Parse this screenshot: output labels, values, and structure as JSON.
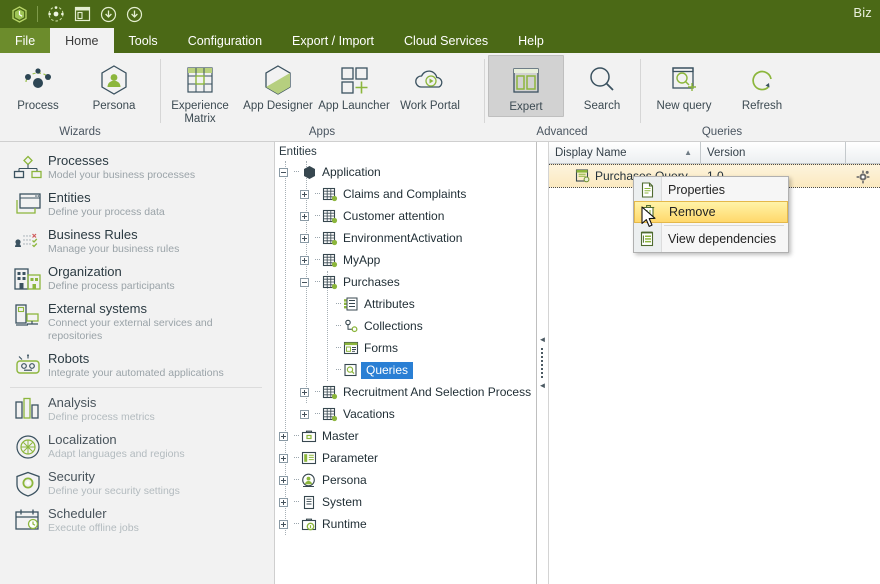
{
  "titlebar": {
    "app_title": "Biz",
    "icons": [
      "app-logo-icon",
      "process-nav-icon",
      "window-layout-icon",
      "download-icon",
      "download-alt-icon"
    ]
  },
  "menubar": {
    "items": [
      {
        "label": "File",
        "state": "file"
      },
      {
        "label": "Home",
        "state": "active"
      },
      {
        "label": "Tools",
        "state": "normal"
      },
      {
        "label": "Configuration",
        "state": "normal"
      },
      {
        "label": "Export / Import",
        "state": "normal"
      },
      {
        "label": "Cloud Services",
        "state": "normal"
      },
      {
        "label": "Help",
        "state": "normal"
      }
    ]
  },
  "ribbon": {
    "groups": [
      {
        "label": "Wizards",
        "buttons": [
          {
            "label": "Process",
            "icon": "process-network-icon",
            "selected": false
          },
          {
            "label": "Persona",
            "icon": "persona-hexagon-icon",
            "selected": false
          }
        ]
      },
      {
        "label": "Apps",
        "buttons": [
          {
            "label": "Experience Matrix",
            "icon": "matrix-grid-icon",
            "selected": false
          },
          {
            "label": "App Designer",
            "icon": "hexagon-designer-icon",
            "selected": false
          },
          {
            "label": "App Launcher",
            "icon": "squares-plus-icon",
            "selected": false
          },
          {
            "label": "Work Portal",
            "icon": "cloud-play-icon",
            "selected": false
          }
        ]
      },
      {
        "label": "Advanced",
        "buttons": [
          {
            "label": "Expert",
            "icon": "panels-expert-icon",
            "selected": true
          },
          {
            "label": "Search",
            "icon": "search-icon",
            "selected": false
          }
        ]
      },
      {
        "label": "Queries",
        "buttons": [
          {
            "label": "New query",
            "icon": "new-query-icon",
            "selected": false
          },
          {
            "label": "Refresh",
            "icon": "refresh-icon",
            "selected": false
          }
        ]
      }
    ]
  },
  "sidebar": {
    "items": [
      {
        "title": "Processes",
        "subtitle": "Model your business processes",
        "icon": "process-tree-icon",
        "dim": false
      },
      {
        "title": "Entities",
        "subtitle": "Define your process data",
        "icon": "entities-window-icon",
        "dim": false
      },
      {
        "title": "Business  Rules",
        "subtitle": "Manage your business rules",
        "icon": "business-rules-icon",
        "dim": false
      },
      {
        "title": "Organization",
        "subtitle": "Define process participants",
        "icon": "organization-building-icon",
        "dim": false
      },
      {
        "title": "External systems",
        "subtitle": "Connect your external services and repositories",
        "icon": "external-systems-icon",
        "dim": false
      },
      {
        "title": "Robots",
        "subtitle": "Integrate your automated applications",
        "icon": "robot-icon",
        "dim": false
      },
      {
        "title": "Analysis",
        "subtitle": "Define  process  metrics",
        "icon": "analysis-bars-icon",
        "dim": true
      },
      {
        "title": "Localization",
        "subtitle": "Adapt  languages  and regions",
        "icon": "globe-icon",
        "dim": true
      },
      {
        "title": "Security",
        "subtitle": "Define  your  security  settings",
        "icon": "shield-gear-icon",
        "dim": true
      },
      {
        "title": "Scheduler",
        "subtitle": "Execute offline  jobs",
        "icon": "calendar-clock-icon",
        "dim": true
      }
    ],
    "divider_after_index": 5
  },
  "tree": {
    "header": "Entities",
    "nodes": [
      {
        "label": "Application",
        "depth": 0,
        "expander": "minus",
        "icon": "application-hex-icon",
        "selected": false
      },
      {
        "label": "Claims and Complaints",
        "depth": 1,
        "expander": "plus",
        "icon": "entity-table-icon",
        "selected": false
      },
      {
        "label": "Customer attention",
        "depth": 1,
        "expander": "plus",
        "icon": "entity-table-icon",
        "selected": false
      },
      {
        "label": "EnvironmentActivation",
        "depth": 1,
        "expander": "plus",
        "icon": "entity-table-icon",
        "selected": false
      },
      {
        "label": "MyApp",
        "depth": 1,
        "expander": "plus",
        "icon": "entity-table-icon",
        "selected": false
      },
      {
        "label": "Purchases",
        "depth": 1,
        "expander": "minus",
        "icon": "entity-table-icon",
        "selected": false
      },
      {
        "label": "Attributes",
        "depth": 2,
        "expander": "none",
        "icon": "attributes-list-icon",
        "selected": false
      },
      {
        "label": "Collections",
        "depth": 2,
        "expander": "none",
        "icon": "collections-icon",
        "selected": false
      },
      {
        "label": "Forms",
        "depth": 2,
        "expander": "none",
        "icon": "forms-icon",
        "selected": false
      },
      {
        "label": "Queries",
        "depth": 2,
        "expander": "none",
        "icon": "queries-icon",
        "selected": true
      },
      {
        "label": "Recruitment And Selection Process",
        "depth": 1,
        "expander": "plus",
        "icon": "entity-table-icon",
        "selected": false
      },
      {
        "label": "Vacations",
        "depth": 1,
        "expander": "plus",
        "icon": "entity-table-icon",
        "selected": false
      },
      {
        "label": "Master",
        "depth": 0,
        "expander": "plus",
        "icon": "master-briefcase-icon",
        "selected": false
      },
      {
        "label": "Parameter",
        "depth": 0,
        "expander": "plus",
        "icon": "parameter-panel-icon",
        "selected": false
      },
      {
        "label": "Persona",
        "depth": 0,
        "expander": "plus",
        "icon": "persona-circle-icon",
        "selected": false
      },
      {
        "label": "System",
        "depth": 0,
        "expander": "plus",
        "icon": "system-doc-icon",
        "selected": false
      },
      {
        "label": "Runtime",
        "depth": 0,
        "expander": "plus",
        "icon": "runtime-briefcase-icon",
        "selected": false
      }
    ]
  },
  "splitter": {
    "collapse_up_icon": "triangle-left-icon",
    "collapse_down_icon": "triangle-left-icon"
  },
  "grid": {
    "columns": [
      {
        "label": "Display Name",
        "sort": "asc",
        "sort_icon": "sort-asc-icon"
      },
      {
        "label": "Version",
        "sort": "none"
      }
    ],
    "rows": [
      {
        "name": "Purchases Query",
        "version": "1.0",
        "icon": "query-row-icon",
        "gear_icon": "gear-icon",
        "selected": true
      }
    ]
  },
  "context_menu": {
    "items": [
      {
        "label": "Properties",
        "icon": "document-icon",
        "highlighted": false
      },
      {
        "label": "Remove",
        "icon": "trash-icon",
        "highlighted": true
      },
      {
        "label": "View dependencies",
        "icon": "dependencies-icon",
        "highlighted": false
      }
    ]
  },
  "colors": {
    "brand_green_dark": "#4b6916",
    "brand_green_light": "#6c8c2c",
    "accent_lime": "#8cb63c",
    "selection_blue": "#2a7fd4",
    "row_highlight": "#fbe9c0",
    "menu_highlight": "#ffd86b"
  }
}
